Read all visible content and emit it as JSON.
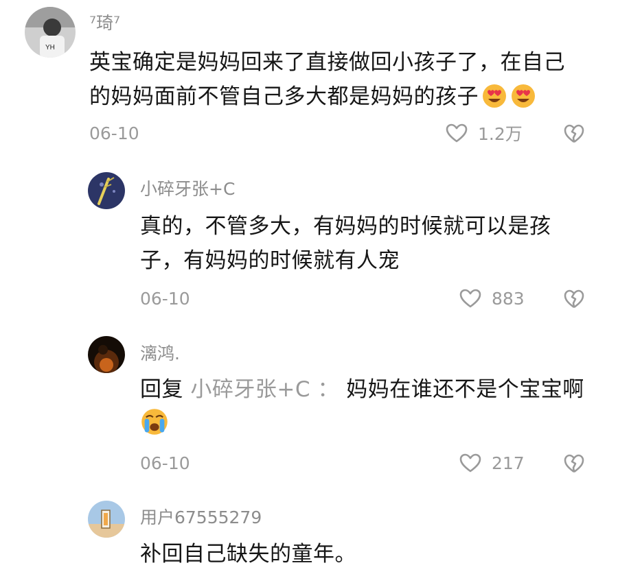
{
  "comments": [
    {
      "username": "⁷琦⁷",
      "text": "英宝确定是妈妈回来了直接做回小孩子了，在自己的妈妈面前不管自己多大都是妈妈的孩子",
      "emoji": [
        "heart-eyes-emoji",
        "heart-eyes-emoji"
      ],
      "date": "06-10",
      "likes": "1.2万"
    },
    {
      "username": "小碎牙张+C",
      "text": "真的，不管多大，有妈妈的时候就可以是孩子，有妈妈的时候就有人宠",
      "date": "06-10",
      "likes": "883"
    },
    {
      "username": "漓鸿.",
      "reply_prefix": "回复",
      "reply_target": "小碎牙张+C",
      "reply_separator": "：",
      "text": "妈妈在谁还不是个宝宝啊",
      "emoji": [
        "crying-emoji"
      ],
      "date": "06-10",
      "likes": "217"
    },
    {
      "username": "用户67555279",
      "text": "补回自己缺失的童年。"
    }
  ]
}
